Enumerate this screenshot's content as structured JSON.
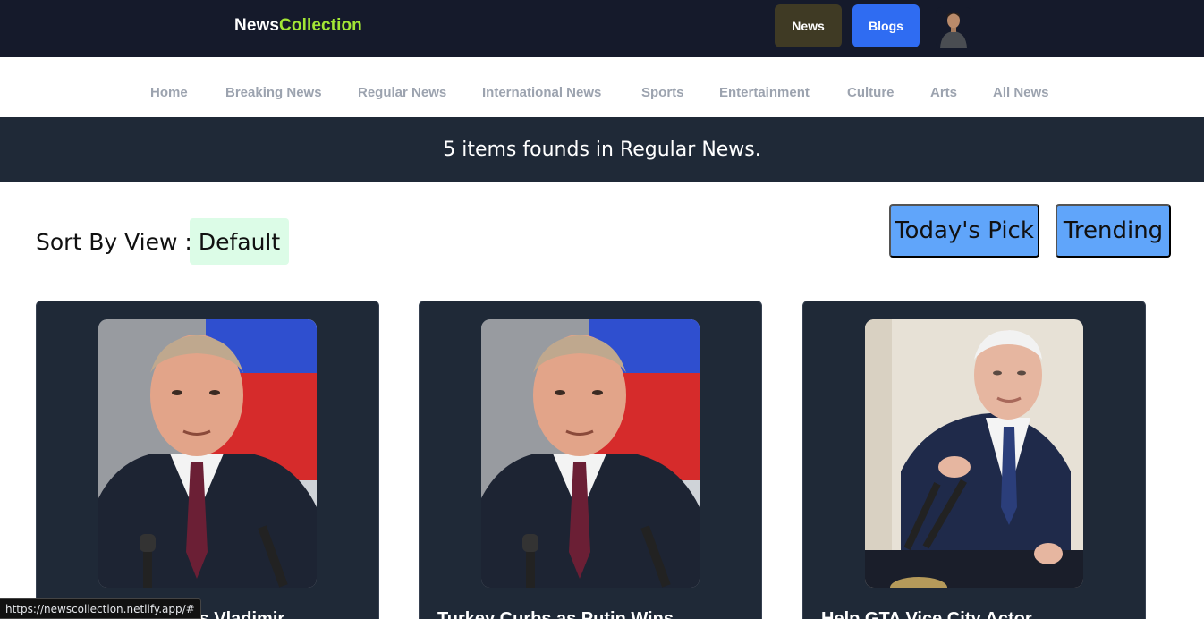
{
  "header": {
    "brand_part1": "News",
    "brand_part2": "Collection",
    "news_button": "News",
    "blogs_button": "Blogs"
  },
  "nav": {
    "items": [
      "Home",
      "Breaking News",
      "Regular News",
      "International News",
      "Sports",
      "Entertainment",
      "Culture",
      "Arts",
      "All News"
    ]
  },
  "banner": {
    "text": "5 items founds in Regular News."
  },
  "sort": {
    "label": "Sort By View :",
    "value": "Default",
    "todays_pick": "Today's Pick",
    "trending": "Trending"
  },
  "cards": [
    {
      "title": "Zelensky Accuses Vladimir"
    },
    {
      "title": "Turkey Curbs as Putin Wins"
    },
    {
      "title": "Help GTA Vice City Actor"
    }
  ],
  "status": {
    "url": "https://newscollection.netlify.app/#"
  },
  "colors": {
    "topbar": "#151a2b",
    "brand_accent": "#a3e635",
    "blogs_button": "#2f6cf2",
    "news_button": "#3f3a24",
    "banner": "#1f2937",
    "sort_default_bg": "#dcfce7",
    "pick_buttons": "#60a5fa"
  }
}
